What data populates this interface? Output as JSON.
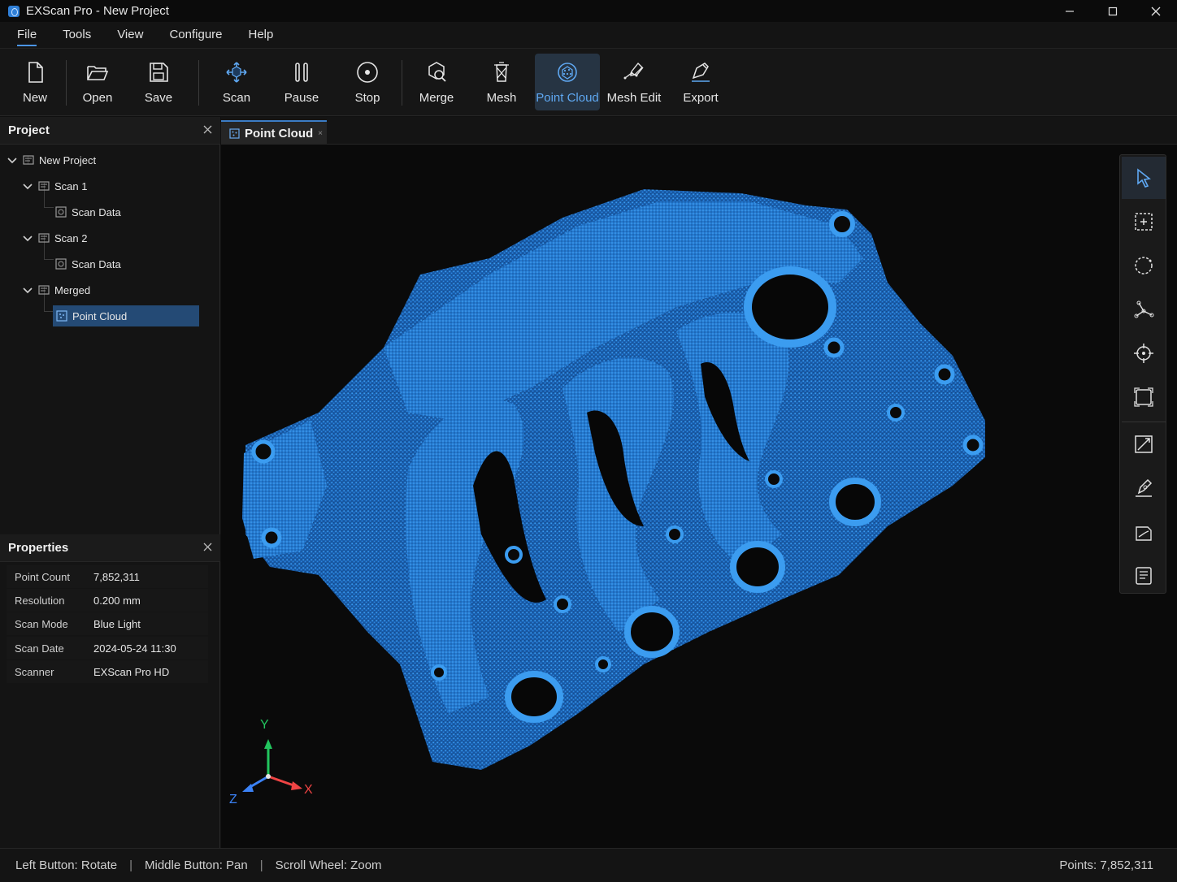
{
  "window": {
    "title": "EXScan Pro - New Project"
  },
  "menu": {
    "items": [
      {
        "label": "File",
        "active": true
      },
      {
        "label": "Tools"
      },
      {
        "label": "View"
      },
      {
        "label": "Configure"
      },
      {
        "label": "Help"
      }
    ]
  },
  "toolbar": {
    "new_label": "New",
    "open_label": "Open",
    "save_label": "Save",
    "scan_label": "Scan",
    "pause_label": "Pause",
    "stop_label": "Stop",
    "merge_label": "Merge",
    "mesh_label": "Mesh",
    "pointcloud_label": "Point Cloud",
    "meshedit_label": "Mesh Edit",
    "export_label": "Export",
    "selected_tool": "Point Cloud"
  },
  "project_panel": {
    "title": "Project",
    "tree": {
      "root": "New Project",
      "scan1": "Scan 1",
      "scan1_data": "Scan Data",
      "scan2": "Scan 2",
      "scan2_data": "Scan Data",
      "merged": "Merged",
      "merged_pointcloud": "Point Cloud"
    },
    "selected": "Point Cloud"
  },
  "properties_panel": {
    "title": "Properties",
    "rows": [
      {
        "key": "Point Count",
        "value": "7,852,311"
      },
      {
        "key": "Resolution",
        "value": "0.200 mm"
      },
      {
        "key": "Scan Mode",
        "value": "Blue Light"
      },
      {
        "key": "Scan Date",
        "value": "2024-05-24 11:30"
      },
      {
        "key": "Scanner",
        "value": "EXScan Pro HD"
      }
    ]
  },
  "document": {
    "tab_label": "Point Cloud",
    "tab_close": "×"
  },
  "axes": {
    "x": "X",
    "y": "Y",
    "z": "Z"
  },
  "status": {
    "rotate": "Left Button: Rotate",
    "pan": "Middle Button: Pan",
    "zoom": "Scroll Wheel: Zoom",
    "separator": "|",
    "points": "Points: 7,852,311"
  },
  "colors": {
    "accent": "#3c8ae0",
    "pointcloud": "#1f78d1",
    "selection": "#244a75"
  }
}
